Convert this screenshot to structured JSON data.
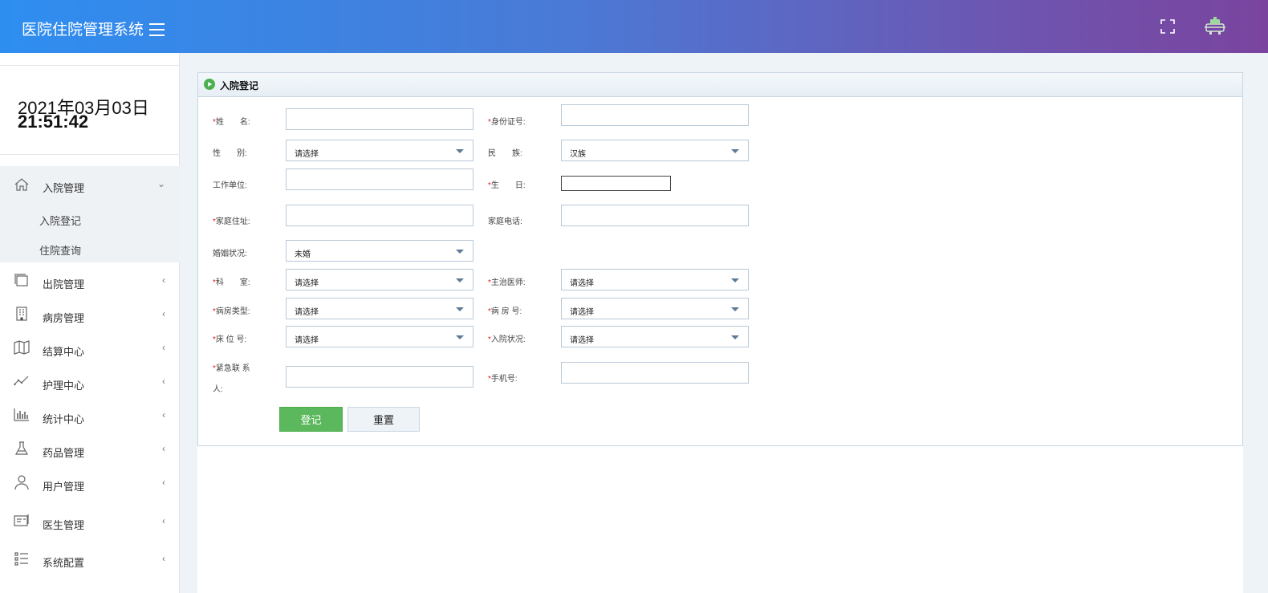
{
  "header": {
    "app_title": "医院住院管理系统"
  },
  "sidebar": {
    "date": "2021年03月03日",
    "time": "21:51:42",
    "menu": [
      {
        "label": "入院管理",
        "icon": "home-icon",
        "expanded": true,
        "children": [
          {
            "label": "入院登记"
          },
          {
            "label": "住院查询"
          }
        ]
      },
      {
        "label": "出院管理",
        "icon": "window-icon"
      },
      {
        "label": "病房管理",
        "icon": "building-icon"
      },
      {
        "label": "结算中心",
        "icon": "map-icon"
      },
      {
        "label": "护理中心",
        "icon": "line-chart-icon"
      },
      {
        "label": "统计中心",
        "icon": "bar-chart-icon"
      },
      {
        "label": "药品管理",
        "icon": "flask-icon"
      },
      {
        "label": "用户管理",
        "icon": "user-icon"
      },
      {
        "label": "医生管理",
        "icon": "id-card-icon"
      },
      {
        "label": "系统配置",
        "icon": "list-icon"
      }
    ]
  },
  "panel": {
    "title": "入院登记"
  },
  "form": {
    "required_mark": "*",
    "name": {
      "label": "姓　　名:",
      "value": ""
    },
    "id_card": {
      "label": "身份证号:",
      "value": ""
    },
    "gender": {
      "label": "性　　别:",
      "selected": "请选择"
    },
    "ethnicity": {
      "label": "民　　族:",
      "selected": "汉族"
    },
    "work_unit": {
      "label": "工作单位:",
      "value": ""
    },
    "birthday": {
      "label": "生　　日:",
      "value": ""
    },
    "home_address": {
      "label": "家庭住址:",
      "value": ""
    },
    "home_phone": {
      "label": "家庭电话:",
      "value": ""
    },
    "marital": {
      "label": "婚姻状况:",
      "selected": "未婚"
    },
    "department": {
      "label": "科　　室:",
      "selected": "请选择"
    },
    "doctor": {
      "label": "主治医师:",
      "selected": "请选择"
    },
    "ward_type": {
      "label": "病房类型:",
      "selected": "请选择"
    },
    "ward_no": {
      "label": "病 房 号:",
      "selected": "请选择"
    },
    "bed_no": {
      "label": "床 位 号:",
      "selected": "请选择"
    },
    "admission_status": {
      "label": "入院状况:",
      "selected": "请选择"
    },
    "emergency_contact": {
      "label_line1": "紧急联 系",
      "label_line2": "人:",
      "value": ""
    },
    "mobile": {
      "label": "手机号:",
      "value": ""
    },
    "submit_label": "登记",
    "reset_label": "重置"
  },
  "colors": {
    "accent_start": "#2e8ef0",
    "accent_end": "#7a449e",
    "submit": "#5cb85c",
    "required": "#e02020"
  }
}
